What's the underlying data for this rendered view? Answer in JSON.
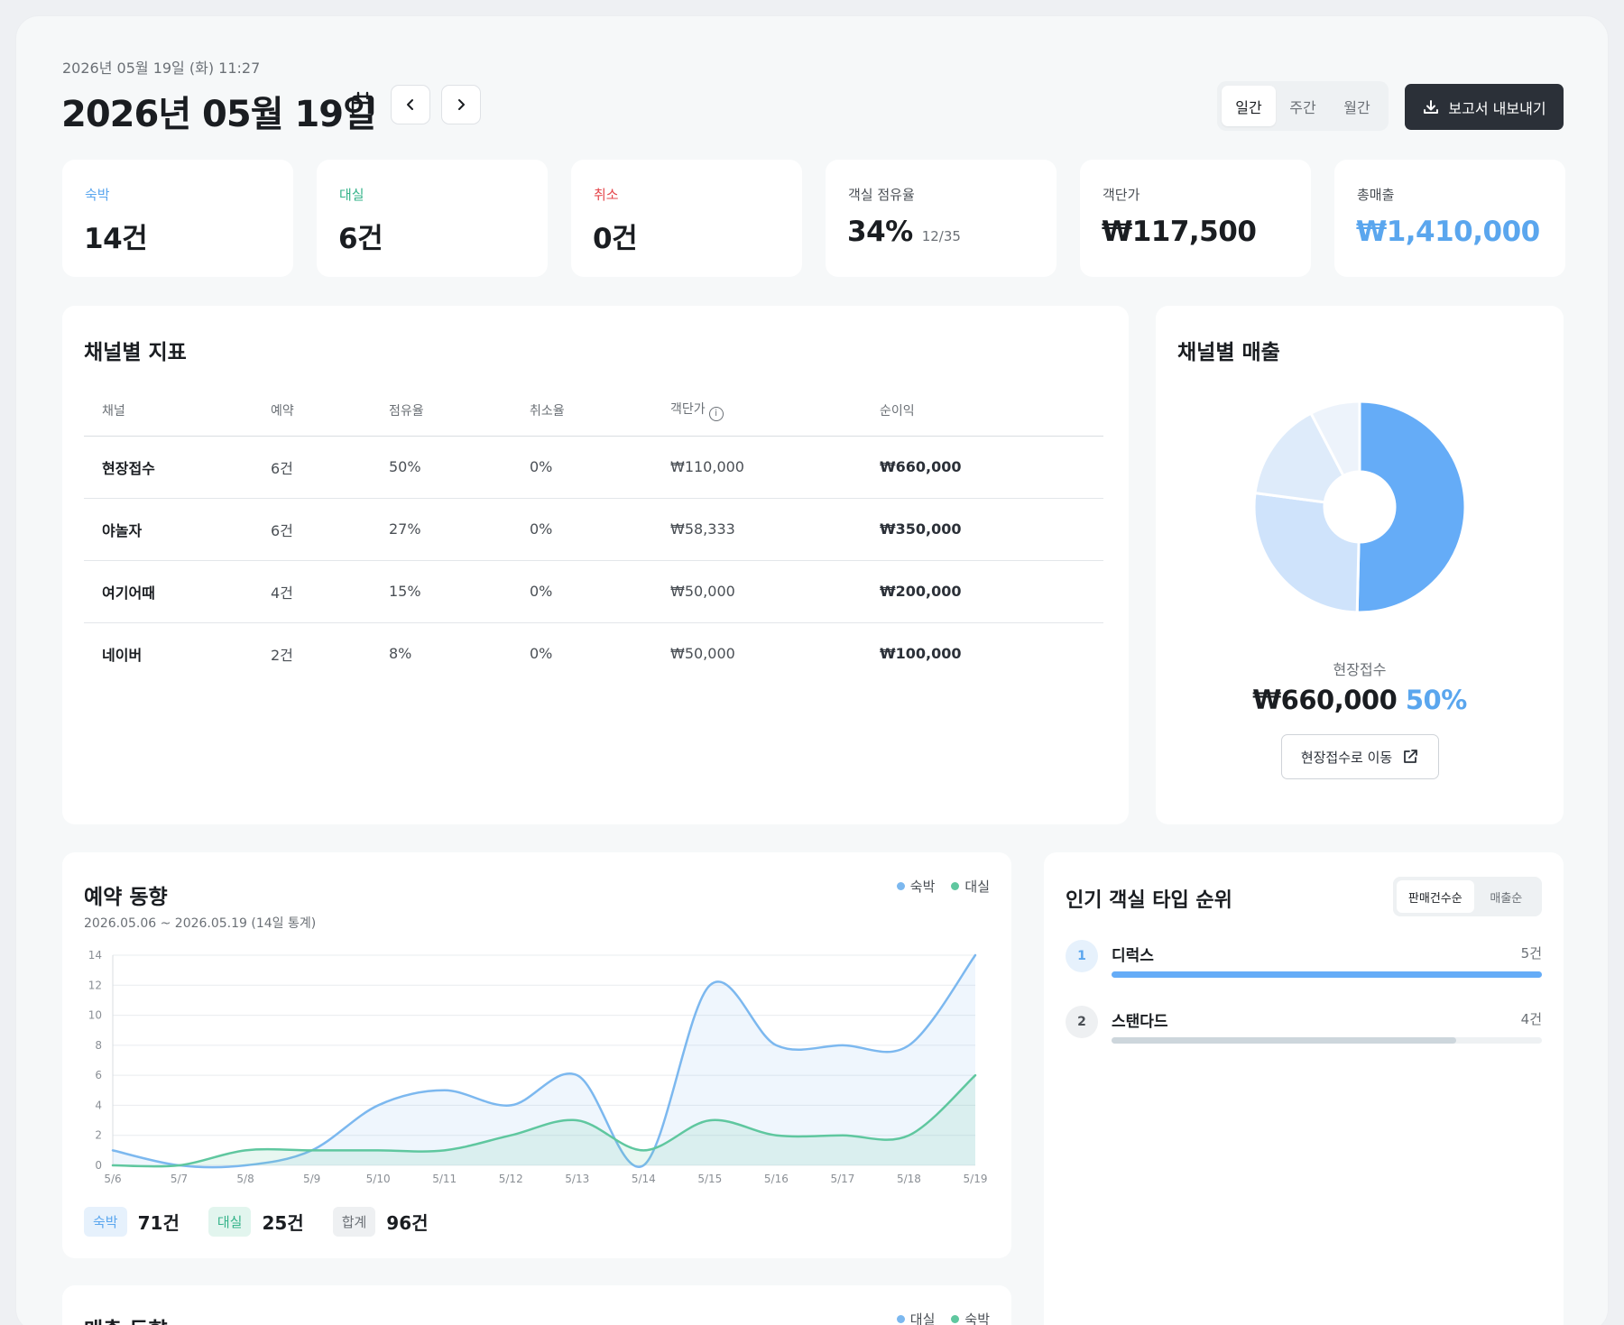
{
  "header": {
    "timestamp": "2026년 05월 19일 (화) 11:27",
    "title": "2026년 05월 19일",
    "period_tabs": [
      "일간",
      "주간",
      "월간"
    ],
    "active_period": "일간",
    "export_label": "보고서 내보내기"
  },
  "kpis": [
    {
      "label": "숙박",
      "value": "14건",
      "label_color": "#5aa6ee"
    },
    {
      "label": "대실",
      "value": "6건",
      "label_color": "#35b38a"
    },
    {
      "label": "취소",
      "value": "0건",
      "label_color": "#e5484d"
    },
    {
      "label": "객실 점유율",
      "value": "34%",
      "sub": "12/35"
    },
    {
      "label": "객단가",
      "value": "₩117,500"
    },
    {
      "label": "총매출",
      "value": "₩1,410,000",
      "value_color": "#5aa6ee"
    }
  ],
  "channel_table": {
    "title": "채널별 지표",
    "columns": [
      "채널",
      "예약",
      "점유율",
      "취소율",
      "객단가",
      "순이익"
    ],
    "rows": [
      [
        "현장접수",
        "6건",
        "50%",
        "0%",
        "₩110,000",
        "₩660,000"
      ],
      [
        "야놀자",
        "6건",
        "27%",
        "0%",
        "₩58,333",
        "₩350,000"
      ],
      [
        "여기어때",
        "4건",
        "15%",
        "0%",
        "₩50,000",
        "₩200,000"
      ],
      [
        "네이버",
        "2건",
        "8%",
        "0%",
        "₩50,000",
        "₩100,000"
      ]
    ]
  },
  "channel_revenue": {
    "title": "채널별 매출",
    "selected_name": "현장접수",
    "selected_amount": "₩660,000",
    "selected_pct": "50%",
    "goto_label": "현장접수로 이동",
    "accent": "#5aa6ee"
  },
  "trend": {
    "title": "예약 동향",
    "subtitle": "2026.05.06 ~ 2026.05.19 (14일 통계)",
    "legend": [
      {
        "name": "숙박",
        "color": "#7cb8ef"
      },
      {
        "name": "대실",
        "color": "#5fc79f"
      }
    ],
    "totals": [
      {
        "label": "숙박",
        "value": "71건",
        "bg": "#e6f1fc",
        "fg": "#5aa6ee"
      },
      {
        "label": "대실",
        "value": "25건",
        "bg": "#e2f5ee",
        "fg": "#35b38a"
      },
      {
        "label": "합계",
        "value": "96건",
        "bg": "#eef0f2",
        "fg": "#6b7076"
      }
    ]
  },
  "revenue_trend": {
    "title": "매출 동향",
    "legend": [
      {
        "name": "대실",
        "color": "#7cb8ef"
      },
      {
        "name": "숙박",
        "color": "#5fc79f"
      }
    ]
  },
  "room_rank": {
    "title": "인기 객실 타입 순위",
    "tabs": [
      "판매건수순",
      "매출순"
    ],
    "active_tab": "판매건수순",
    "items": [
      {
        "rank": "1",
        "name": "디럭스",
        "count": "5건",
        "share": 1.0
      },
      {
        "rank": "2",
        "name": "스탠다드",
        "count": "4건",
        "share": 0.8
      }
    ]
  },
  "chart_data": [
    {
      "type": "pie",
      "title": "채널별 매출",
      "categories": [
        "현장접수",
        "야놀자",
        "여기어때",
        "네이버"
      ],
      "values": [
        660000,
        350000,
        200000,
        100000
      ],
      "colors": [
        "#65acf7",
        "#cfe3fb",
        "#deebfa",
        "#edf3fb"
      ]
    },
    {
      "type": "area",
      "title": "예약 동향",
      "categories": [
        "5/6",
        "5/7",
        "5/8",
        "5/9",
        "5/10",
        "5/11",
        "5/12",
        "5/13",
        "5/14",
        "5/15",
        "5/16",
        "5/17",
        "5/18",
        "5/19"
      ],
      "yticks": [
        0,
        2,
        4,
        6,
        8,
        10,
        12,
        14
      ],
      "ylim": [
        0,
        14
      ],
      "grid": true,
      "series": [
        {
          "name": "숙박",
          "color": "#7cb8ef",
          "values": [
            1,
            0,
            0,
            1,
            4,
            5,
            4,
            6,
            0,
            12,
            8,
            8,
            8,
            14
          ]
        },
        {
          "name": "대실",
          "color": "#5fc79f",
          "values": [
            0,
            0,
            1,
            1,
            1,
            1,
            2,
            3,
            1,
            3,
            2,
            2,
            2,
            6
          ]
        }
      ]
    }
  ]
}
